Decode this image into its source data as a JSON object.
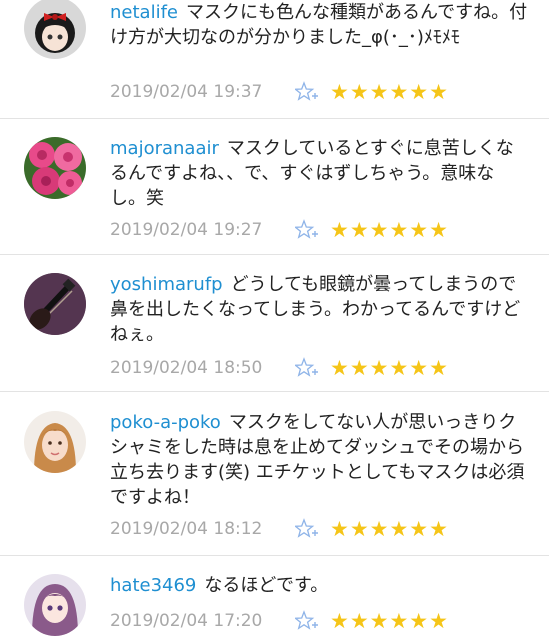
{
  "comments": [
    {
      "user": "netalife",
      "text": "マスクにも色んな種類があるんですね。付け方が大切なのが分かりました_φ(･_･)ﾒﾓﾒﾓ",
      "date": "2019/02/04 19:37",
      "stars": "★★★★★★",
      "avatar_icon": "anime-girl-red-bow-avatar"
    },
    {
      "user": "majoranaair",
      "text": "マスクしているとすぐに息苦しくなるんですよね、、で、すぐはずしちゃう。意味なし。笑",
      "date": "2019/02/04 19:27",
      "stars": "★★★★★★",
      "avatar_icon": "pink-roses-avatar"
    },
    {
      "user": "yoshimarufp",
      "text": "どうしても眼鏡が曇ってしまうので鼻を出したくなってしまう。わかってるんですけどねぇ。",
      "date": "2019/02/04 18:50",
      "stars": "★★★★★★",
      "avatar_icon": "guitar-avatar"
    },
    {
      "user": "poko-a-poko",
      "text": "マスクをしてない人が思いっきりクシャミをした時は息を止めてダッシュでその場から立ち去ります(笑) エチケットとしてもマスクは必須ですよね！",
      "date": "2019/02/04 18:12",
      "stars": "★★★★★★",
      "avatar_icon": "woman-portrait-avatar"
    },
    {
      "user": "hate3469",
      "text": "なるほどです。",
      "date": "2019/02/04 17:20",
      "stars": "★★★★★★",
      "avatar_icon": "anime-girl-avatar"
    }
  ],
  "colors": {
    "username": "#1f8fd1",
    "date": "#a8a8a8",
    "star": "#f5c518",
    "fav_icon": "#8fb4e8"
  }
}
